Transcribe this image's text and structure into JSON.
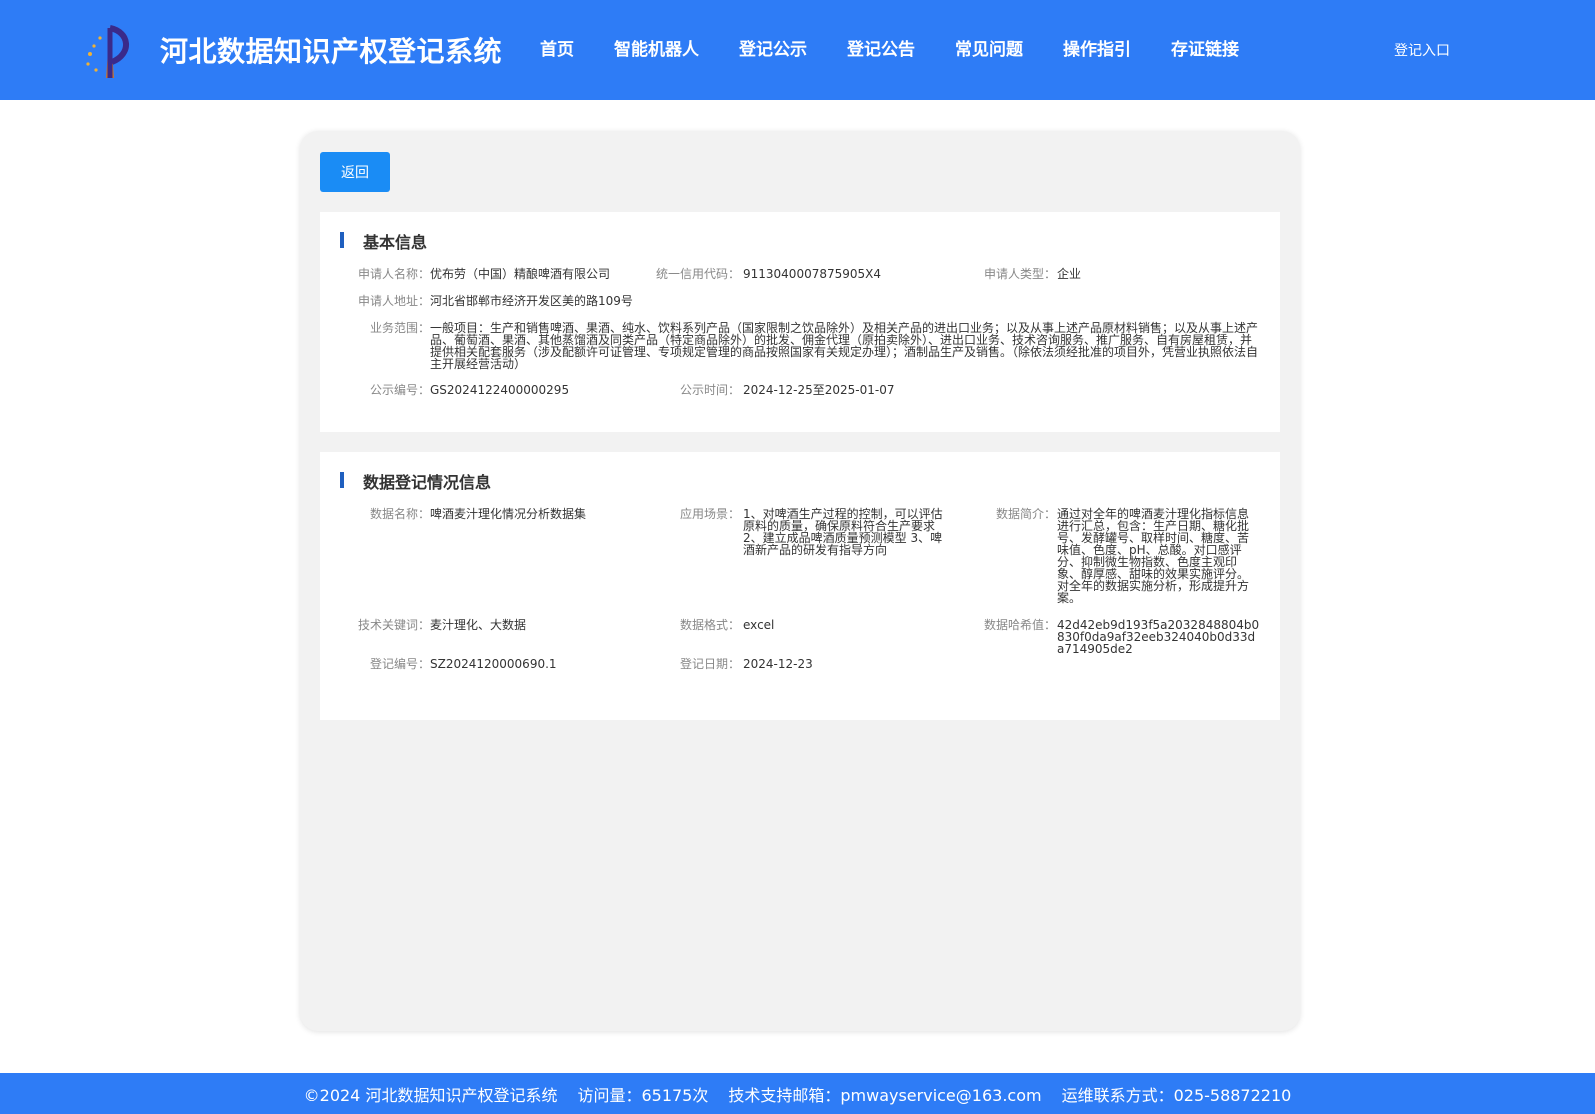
{
  "header": {
    "site_title": "河北数据知识产权登记系统",
    "nav": [
      "首页",
      "智能机器人",
      "登记公示",
      "登记公告",
      "常见问题",
      "操作指引",
      "存证链接"
    ],
    "login_label": "登记入口",
    "brand_color": "#2e7cf6",
    "logo_icon": "emblem-logo"
  },
  "toolbar": {
    "back_label": "返回",
    "back_color": "#1a8cf5"
  },
  "basic_info": {
    "title": "基本信息",
    "applicant_name_label": "申请人名称：",
    "applicant_name": "优布劳（中国）精酿啤酒有限公司",
    "credit_code_label": "统一信用代码：",
    "credit_code": "9113040007875905X4",
    "applicant_type_label": "申请人类型：",
    "applicant_type": "企业",
    "address_label": "申请人地址：",
    "address": "河北省邯郸市经济开发区美的路109号",
    "scope_label": "业务范围：",
    "scope": "一般项目：生产和销售啤酒、果酒、纯水、饮料系列产品（国家限制之饮品除外）及相关产品的进出口业务；以及从事上述产品原材料销售；以及从事上述产品、葡萄酒、果酒、其他蒸馏酒及同类产品（特定商品除外）的批发、佣金代理（原拍卖除外）、进出口业务、技术咨询服务、推广服务、自有房屋租赁，并提供相关配套服务（涉及配额许可证管理、专项规定管理的商品按照国家有关规定办理）；酒制品生产及销售。（除依法须经批准的项目外，凭营业执照依法自主开展经营活动）",
    "pub_no_label": "公示编号：",
    "pub_no": "GS2024122400000295",
    "pub_time_label": "公示时间：",
    "pub_time": "2024-12-25至2025-01-07"
  },
  "data_info": {
    "title": "数据登记情况信息",
    "data_name_label": "数据名称：",
    "data_name": "啤酒麦汁理化情况分析数据集",
    "scenario_label": "应用场景：",
    "scenario": "1、对啤酒生产过程的控制，可以评估原料的质量，确保原料符合生产要求 2、建立成品啤酒质量预测模型 3、啤酒新产品的研发有指导方向",
    "intro_label": "数据简介：",
    "intro": "通过对全年的啤酒麦汁理化指标信息进行汇总，包含：生产日期、糖化批号、发酵罐号、取样时间、糖度、苦味值、色度、pH、总酸。对口感评分、抑制微生物指数、色度主观印象、醇厚感、甜味的效果实施评分。对全年的数据实施分析，形成提升方案。",
    "keywords_label": "技术关键词：",
    "keywords": "麦汁理化、大数据",
    "format_label": "数据格式：",
    "format": "excel",
    "hash_label": "数据哈希值：",
    "hash": "42d42eb9d193f5a2032848804b0830f0da9af32eeb324040b0d33da714905de2",
    "reg_no_label": "登记编号：",
    "reg_no": "SZ2024120000690.1",
    "reg_date_label": "登记日期：",
    "reg_date": "2024-12-23"
  },
  "footer": {
    "copyright": "©2024 河北数据知识产权登记系统",
    "visits": "访问量：65175次",
    "email": "技术支持邮箱：pmwayservice@163.com",
    "contact": "运维联系方式：025-58872210"
  }
}
